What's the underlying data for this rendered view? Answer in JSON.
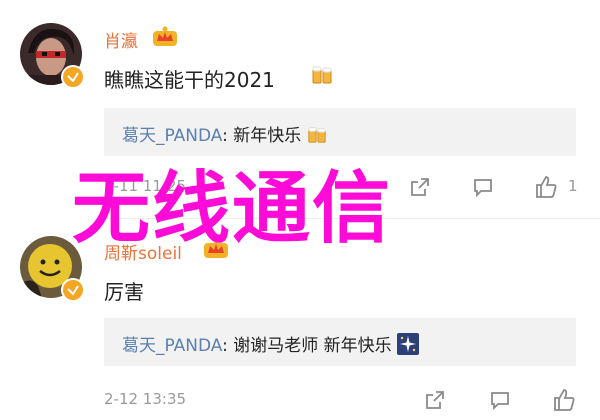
{
  "comments": [
    {
      "username": "肖瀛",
      "text": "瞧瞧这能干的2021",
      "reply": {
        "name": "葛天_PANDA",
        "sep": ": ",
        "text": "新年快乐"
      },
      "timestamp": "2-11 11:25",
      "like_count": "1"
    },
    {
      "username": "周靳soleil",
      "text": "厉害",
      "reply": {
        "name": "葛天_PANDA",
        "sep": ": ",
        "text": "谢谢马老师 新年快乐"
      },
      "timestamp": "2-12 13:35",
      "like_count": ""
    }
  ],
  "overlay_text": "无线通信",
  "colors": {
    "username": "#e8743b",
    "reply_name": "#5b80b0",
    "overlay": "#ff0bd8",
    "badge": "#f5a623"
  },
  "icons": [
    "crown-badge-icon",
    "verified-badge-icon",
    "beer-emoji-icon",
    "sparkle-emoji-icon",
    "share-icon",
    "comment-icon",
    "like-icon"
  ]
}
